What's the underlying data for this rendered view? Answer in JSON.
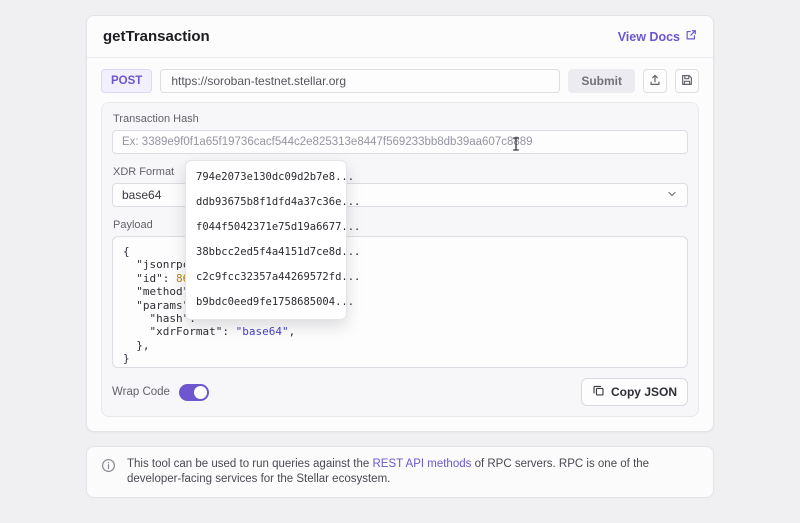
{
  "colors": {
    "accent": "#6e56cf",
    "page_bg": "#f0f0f3",
    "card_bg": "#fcfcfd",
    "panel_bg": "#f7f7f9",
    "json_number": "#b8860b",
    "json_string": "#4843c8"
  },
  "header": {
    "title": "getTransaction",
    "docs_link_label": "View Docs"
  },
  "request_bar": {
    "method": "POST",
    "url": "https://soroban-testnet.stellar.org",
    "submit_label": "Submit"
  },
  "form": {
    "tx_hash_label": "Transaction Hash",
    "tx_hash_placeholder": "Ex: 3389e9f0f1a65f19736cacf544c2e825313e8447f569233bb8db39aa607c8889",
    "xdr_format_label": "XDR Format",
    "xdr_format_value": "base64",
    "payload_label": "Payload"
  },
  "suggestions": [
    "794e2073e130dc09d2b7e8...",
    "ddb93675b8f1dfd4a37c36e...",
    "f044f5042371e75d19a6677...",
    "38bbcc2ed5f4a4151d7ce8d...",
    "c2c9fcc32357a44269572fd...",
    "b9bdc0eed9fe1758685004..."
  ],
  "payload": {
    "line_open": "{",
    "line_jsonrpc": "  \"jsonrpc\": \"",
    "line_id_key": "  \"id\": ",
    "line_id_value": "86753",
    "line_method": "  \"method\": \"",
    "line_params": "  \"params\": {",
    "line_hash": "    \"hash\": \"",
    "line_xdr_key": "    \"xdrFormat\": ",
    "line_xdr_value": "\"base64\"",
    "line_xdr_comma": ",",
    "line_close_params": "  },",
    "line_close": "}"
  },
  "footer_controls": {
    "wrap_code_label": "Wrap Code",
    "copy_json_label": "Copy JSON"
  },
  "info_banner": {
    "text_before_link": "This tool can be used to run queries against the ",
    "link_text": "REST API methods",
    "text_after_link": " of RPC servers. RPC is one of the developer-facing services for the Stellar ecosystem."
  }
}
